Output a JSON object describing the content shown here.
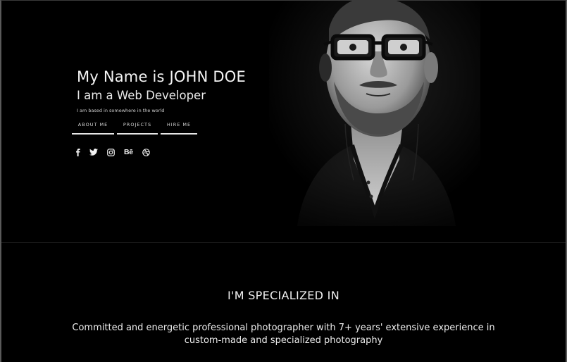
{
  "hero": {
    "title": "My Name is JOHN DOE",
    "subtitle": "I am a Web Developer",
    "location": "I am based in somewhere in the world",
    "nav": [
      {
        "label": "ABOUT ME"
      },
      {
        "label": "PROJECTS"
      },
      {
        "label": "HIRE ME"
      }
    ],
    "social": [
      {
        "icon": "facebook-icon"
      },
      {
        "icon": "twitter-icon"
      },
      {
        "icon": "instagram-icon"
      },
      {
        "icon": "behance-icon",
        "text": "Bē"
      },
      {
        "icon": "dribbble-icon"
      }
    ]
  },
  "specialized": {
    "heading": "I'M SPECIALIZED IN",
    "body": "Committed and energetic professional photographer with 7+ years' extensive experience in custom-made and specialized photography"
  },
  "colors": {
    "background": "#000000",
    "text": "#ffffff",
    "frame_border": "#5a5a5a"
  }
}
